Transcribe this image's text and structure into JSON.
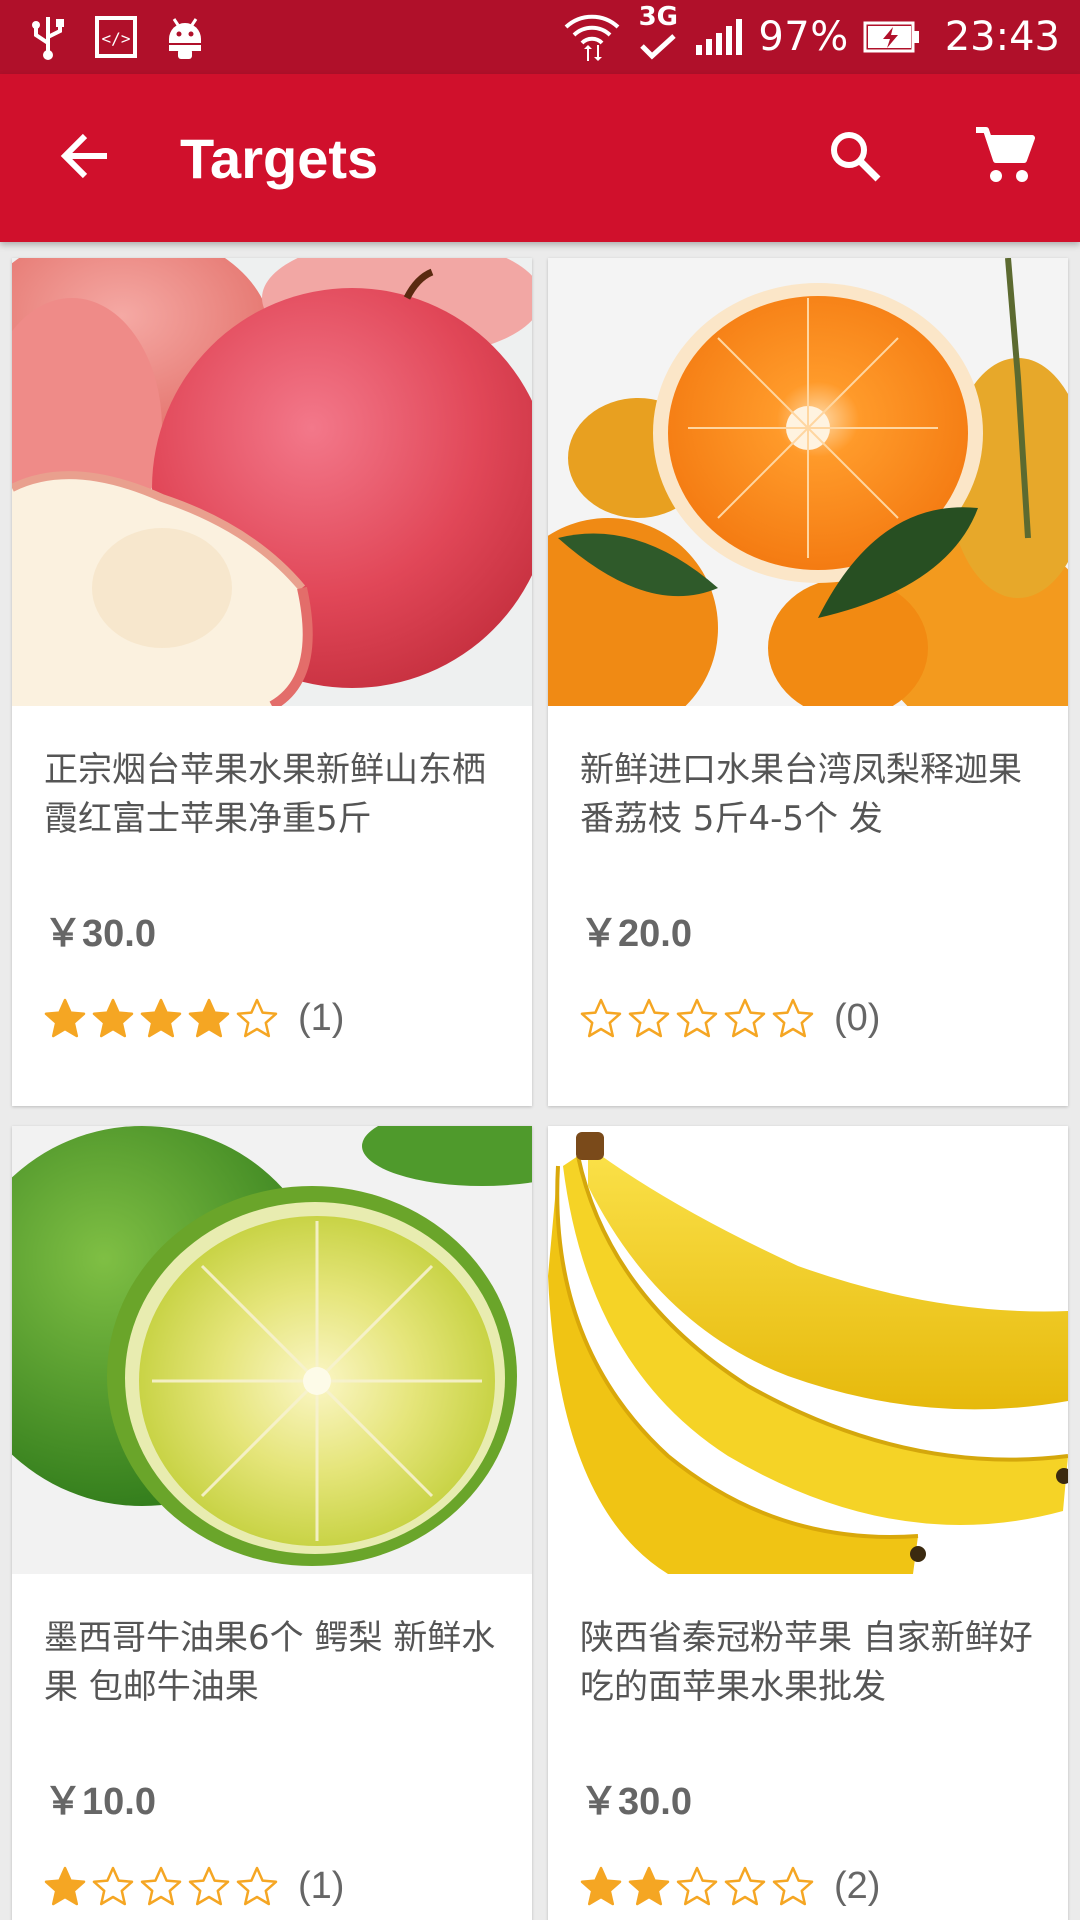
{
  "status_bar": {
    "network": "3G",
    "battery": "97%",
    "time": "23:43"
  },
  "app_bar": {
    "title": "Targets",
    "icons": [
      "back-arrow-icon",
      "search-icon",
      "cart-icon"
    ]
  },
  "products": [
    {
      "image": "apple-photo",
      "title": "正宗烟台苹果水果新鲜山东栖霞红富士苹果净重5斤",
      "price": "￥30.0",
      "rating": 4,
      "max_rating": 5,
      "review_count": "(1)"
    },
    {
      "image": "orange-photo",
      "title": "新鲜进口水果台湾凤梨释迦果 番荔枝 5斤4-5个 发",
      "price": "￥20.0",
      "rating": 0,
      "max_rating": 5,
      "review_count": "(0)"
    },
    {
      "image": "lime-photo",
      "title": "墨西哥牛油果6个 鳄梨 新鲜水果 包邮牛油果",
      "price": "￥10.0",
      "rating": 1,
      "max_rating": 5,
      "review_count": "(1)"
    },
    {
      "image": "banana-photo",
      "title": "陕西省秦冠粉苹果 自家新鲜好吃的面苹果水果批发",
      "price": "￥30.0",
      "rating": 2,
      "max_rating": 5,
      "review_count": "(2)"
    }
  ],
  "colors": {
    "status_bar": "#b0102a",
    "app_bar": "#d0102c",
    "star": "#f5a623"
  }
}
